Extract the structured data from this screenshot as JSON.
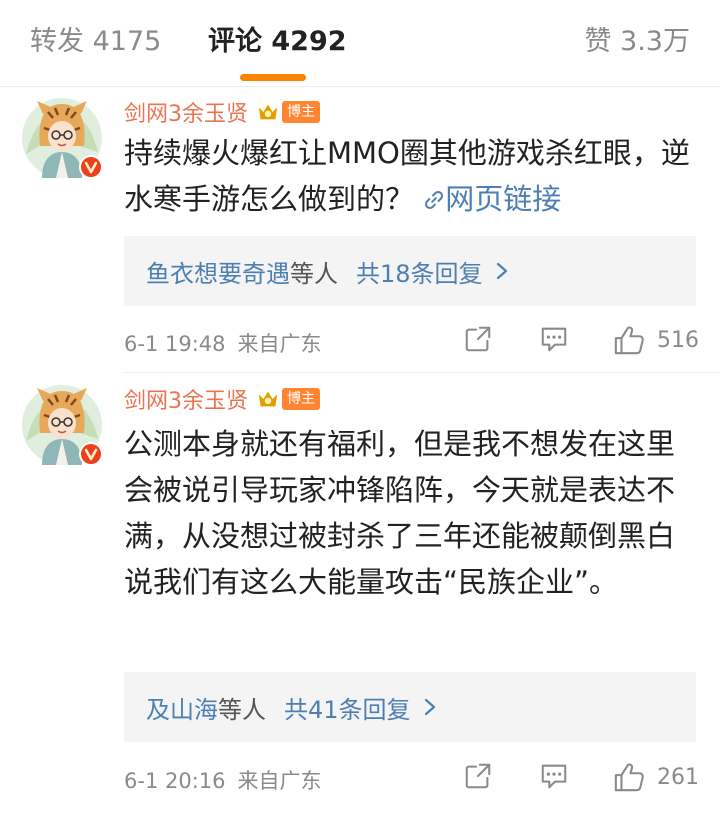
{
  "tabs": {
    "repost": "转发 4175",
    "comments": "评论 4292",
    "likes": "赞 3.3万"
  },
  "colors": {
    "accent": "#ff8200",
    "username": "#eb7350",
    "link": "#4d7fb3",
    "badge": "#ff8533"
  },
  "comments": [
    {
      "username": "剑网3余玉贤",
      "badge": "博主",
      "text": "持续爆火爆红让MMO圈其他游戏杀红眼，逆水寒手游怎么做到的？",
      "link_text": "网页链接",
      "link_icon": "link-icon",
      "reply_users": "鱼衣想要奇遇",
      "reply_suffix": "等人",
      "reply_count": "共18条回复",
      "time": "6-1 19:48",
      "place": "来自广东",
      "likes": "516"
    },
    {
      "username": "剑网3余玉贤",
      "badge": "博主",
      "text": "公测本身就还有福利，但是我不想发在这里会被说引导玩家冲锋陷阵，今天就是表达不满，从没想过被封杀了三年还能被颠倒黑白说我们有这么大能量攻击“民族企业”。",
      "reply_users": "及山海",
      "reply_suffix": "等人",
      "reply_count": "共41条回复",
      "time": "6-1 20:16",
      "place": "来自广东",
      "likes": "261"
    }
  ]
}
